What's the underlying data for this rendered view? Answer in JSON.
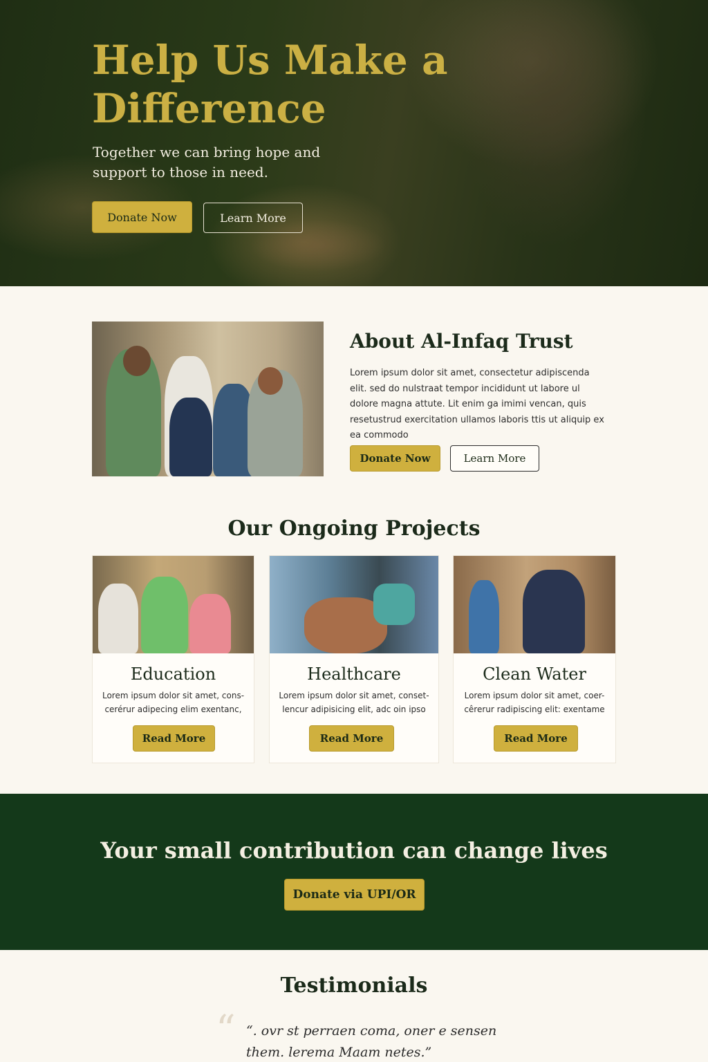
{
  "hero": {
    "title": "Help Us Make a Difference",
    "subtitle": "Together we can bring hope and support to those in need.",
    "donate_label": "Donate Now",
    "learn_label": "Learn More"
  },
  "about": {
    "title": "About Al-Infaq Trust",
    "text": "Lorem ipsum dolor sit amet, consectetur adipiscenda elit. sed do nulstraat tempor incididunt ut labore ul dolore magna attute. Lit enim ga imimi vencan, quis resetustrud exercitation ullamos laboris ttis ut aliquip ex ea commodo",
    "donate_label": "Donate Now",
    "learn_label": "Learn More"
  },
  "projects": {
    "title": "Our Ongoing Projects",
    "items": [
      {
        "title": "Education",
        "text": "Lorem ipsum dolor sit amet, cons-cerérur adipecing elim exentanc,",
        "button": "Read More"
      },
      {
        "title": "Healthcare",
        "text": "Lorem ipsum dolor sit amet, conset-lencur adipisicing elit, adc oin ipso",
        "button": "Read More"
      },
      {
        "title": "Clean Water",
        "text": "Lorem ipsum dolor sit amet, coer-cêrerur radipiscing elit: exentame",
        "button": "Read More"
      }
    ]
  },
  "cta": {
    "title": "Your small contribution can change lives",
    "button": "Donate via UPI/OR"
  },
  "testimonials": {
    "title": "Testimonials",
    "quote": "“. ovr st perraen coma, oner e sensen them. lerema Maam netes.”"
  },
  "colors": {
    "gold": "#cfb03e",
    "dark_green": "#14391a",
    "cream": "#faf7f0"
  }
}
